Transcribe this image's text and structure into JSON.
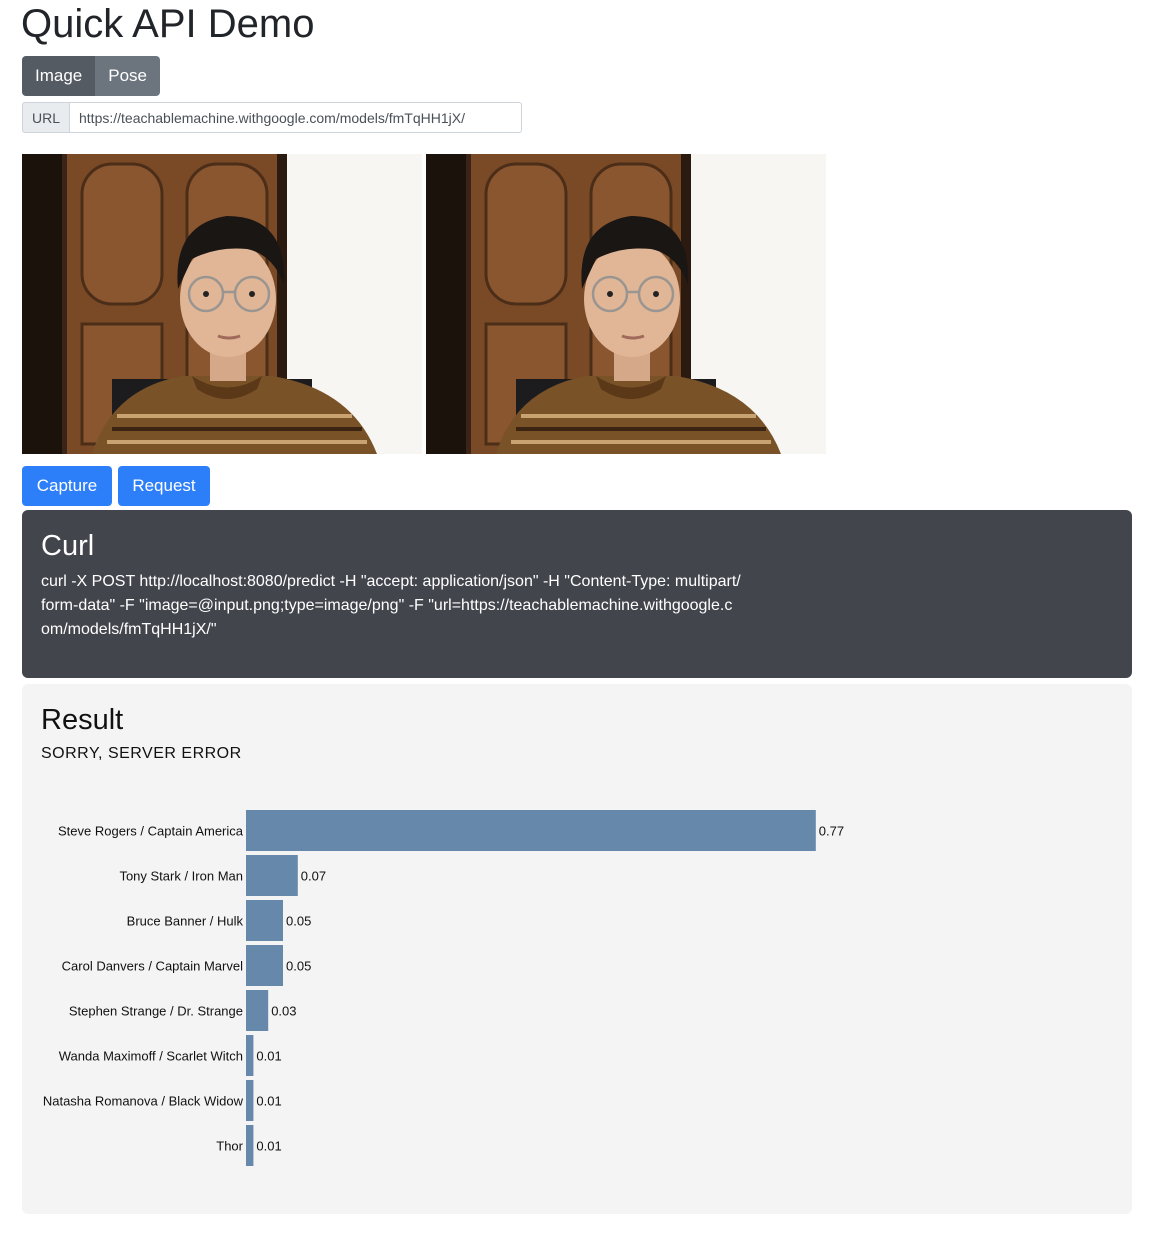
{
  "title": "Quick API Demo",
  "mode_tabs": [
    {
      "label": "Image",
      "active": true
    },
    {
      "label": "Pose",
      "active": false
    }
  ],
  "url": {
    "label": "URL",
    "value": "https://teachablemachine.withgoogle.com/models/fmTqHH1jX/"
  },
  "buttons": {
    "capture": "Capture",
    "request": "Request"
  },
  "curl": {
    "title": "Curl",
    "command": "curl -X POST http://localhost:8080/predict -H \"accept: application/json\" -H \"Content-Type: multipart/form-data\" -F \"image=@input.png;type=image/png\" -F \"url=https://teachablemachine.withgoogle.com/models/fmTqHH1jX/\""
  },
  "result": {
    "title": "Result",
    "status": "SORRY, SERVER ERROR"
  },
  "colors": {
    "primary_button": "#2d7ff9",
    "bar": "#6688aa",
    "curl_bg": "#43454d"
  },
  "chart_data": {
    "type": "bar",
    "orientation": "horizontal",
    "categories": [
      "Steve Rogers / Captain America",
      "Tony Stark / Iron Man",
      "Bruce Banner / Hulk",
      "Carol Danvers / Captain Marvel",
      "Stephen Strange / Dr. Strange",
      "Wanda Maximoff / Scarlet Witch",
      "Natasha Romanova / Black Widow",
      "Thor"
    ],
    "values": [
      0.77,
      0.07,
      0.05,
      0.05,
      0.03,
      0.01,
      0.01,
      0.01
    ],
    "value_labels": [
      "0.77",
      "0.07",
      "0.05",
      "0.05",
      "0.03",
      "0.01",
      "0.01",
      "0.01"
    ],
    "xlim": [
      0,
      1
    ],
    "grid": false
  }
}
